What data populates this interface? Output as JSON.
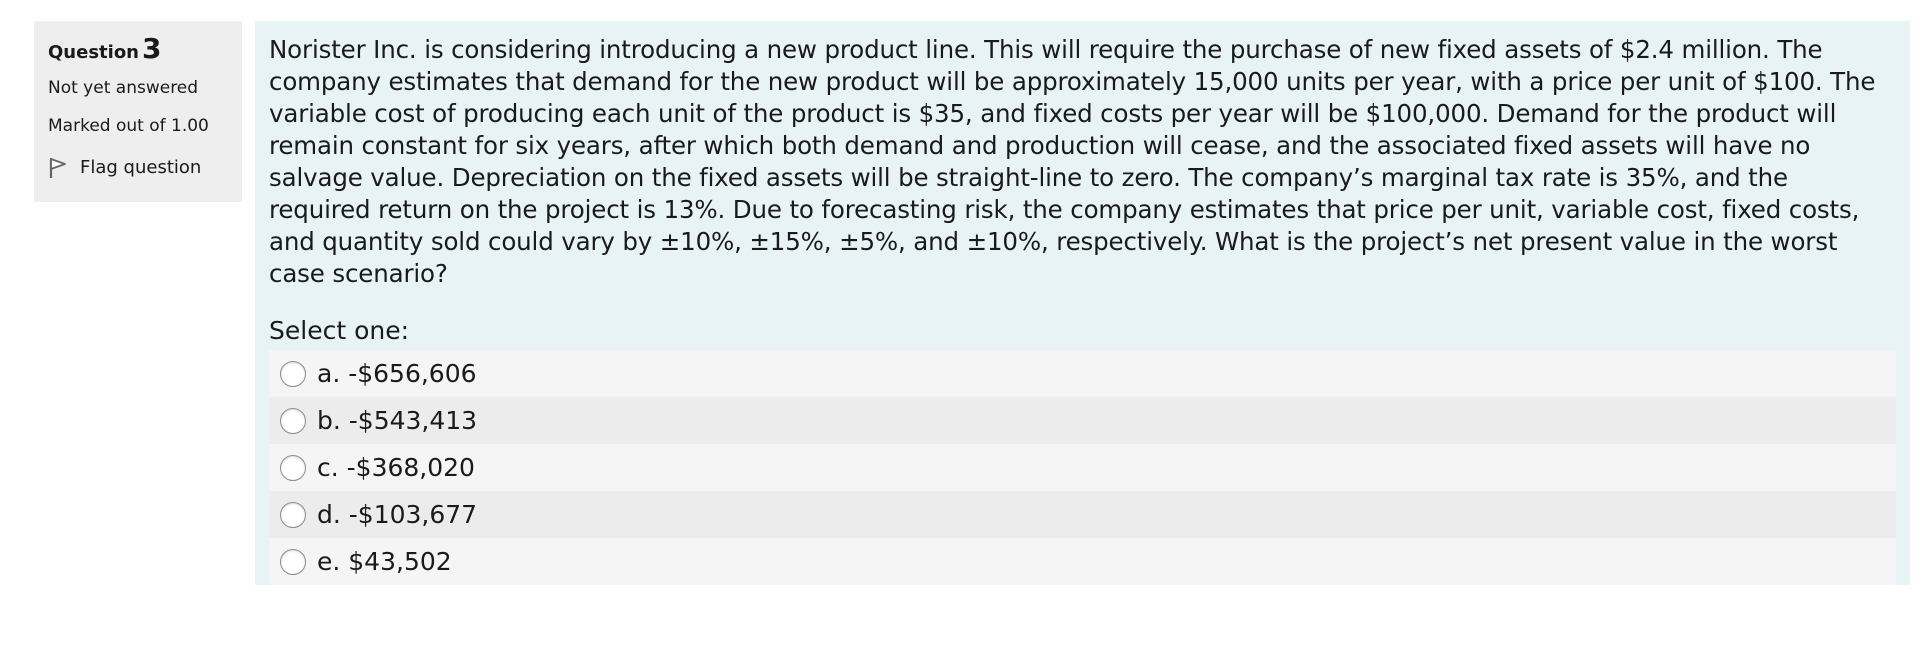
{
  "info": {
    "question_label": "Question",
    "question_number": "3",
    "state": "Not yet answered",
    "grade": "Marked out of 1.00",
    "flag_label": "Flag question"
  },
  "question": {
    "text": "Norister Inc. is considering introducing a new product line. This will require the purchase of new fixed assets of $2.4 million. The company estimates that demand for the new product will be approximately 15,000 units per year, with a price per unit of $100. The variable cost of producing each unit of the product is $35, and fixed costs per year will be $100,000. Demand for the product will remain constant for six years, after which both demand and production will cease, and the associated fixed assets will have no salvage value. Depreciation on the fixed assets will be straight-line to zero. The company’s marginal tax rate is 35%, and the required return on the project is 13%. Due to forecasting risk, the company estimates that price per unit, variable cost, fixed costs, and quantity sold could vary by ±10%, ±15%, ±5%, and ±10%, respectively. What is the project’s net present value in the worst case scenario?",
    "prompt": "Select one:",
    "answers": [
      {
        "label": "a. -$656,606"
      },
      {
        "label": "b. -$543,413"
      },
      {
        "label": "c. -$368,020"
      },
      {
        "label": "d. -$103,677"
      },
      {
        "label": "e. $43,502"
      }
    ]
  },
  "colors": {
    "info_background": "#eeeeee",
    "content_background": "#e7f3f5"
  },
  "icons": {
    "flag": "flag-icon",
    "radio": "radio-unchecked-icon"
  }
}
